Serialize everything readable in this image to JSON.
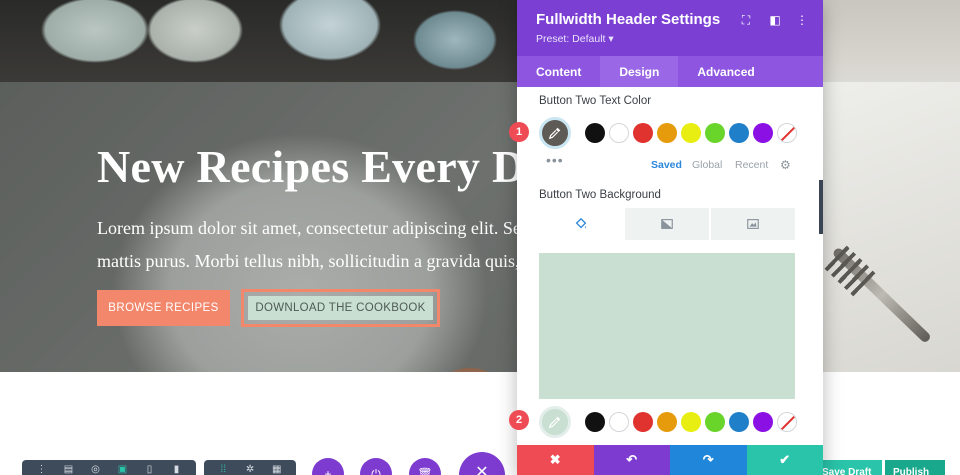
{
  "hero": {
    "title": "New Recipes Every Da",
    "text_line1": "Lorem ipsum dolor sit amet, consectetur adipiscing elit. Sed",
    "text_line2": "mattis purus. Morbi tellus nibh, sollicitudin a gravida quis,",
    "button_one": "BROWSE RECIPES",
    "button_two": "DOWNLOAD THE COOKBOOK"
  },
  "panel": {
    "title": "Fullwidth Header Settings",
    "preset": "Preset: Default ▾",
    "tabs": [
      "Content",
      "Design",
      "Advanced"
    ],
    "active_tab": "Design",
    "field_one_label": "Button Two Text Color",
    "field_two_label": "Button Two Background",
    "palette_tabs": [
      "Saved",
      "Global",
      "Recent"
    ],
    "badges": [
      "1",
      "2"
    ],
    "footer_icons": [
      "close-icon",
      "undo-icon",
      "redo-icon",
      "check-icon"
    ]
  },
  "swatches": [
    "#111111",
    "#ffffff",
    "#e0322e",
    "#e69b0c",
    "#e8ee12",
    "#69d42a",
    "#1f7fc9",
    "#8a10e3",
    "none"
  ],
  "colors": {
    "accent_purple": "#7b3fd4",
    "hero_button": "#f2876c",
    "button_two_bg": "#c8dfd2",
    "text_color_selected": "#5e5a55",
    "bg_color_selected": "#c8dfd2",
    "footer_red": "#ef4b55",
    "footer_purple": "#7e3bd0",
    "footer_blue": "#2086da",
    "footer_green": "#29c4a9"
  },
  "bottom_bar": {
    "save_draft": "Save Draft",
    "publish": "Publish"
  }
}
